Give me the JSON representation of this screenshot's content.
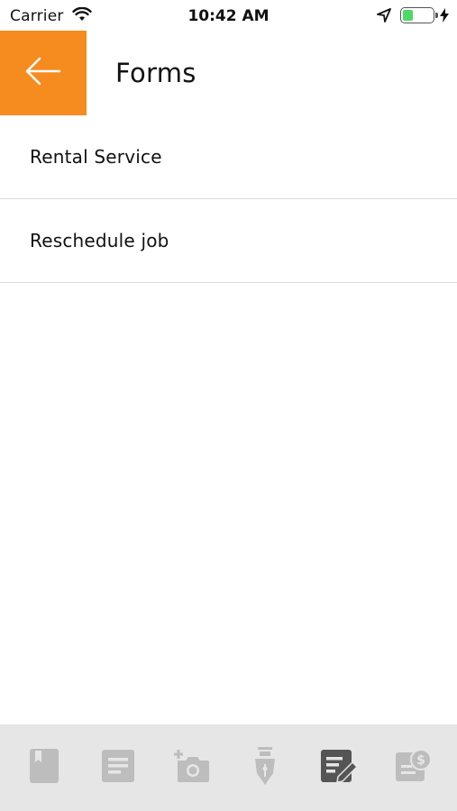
{
  "status_bar": {
    "carrier": "Carrier",
    "time": "10:42 AM",
    "battery_level": 0.3,
    "icons": [
      "wifi-icon",
      "location-arrow-icon",
      "battery-icon",
      "charging-bolt-icon"
    ]
  },
  "header": {
    "back_icon": "arrow-left-icon",
    "title": "Forms",
    "accent_color": "#f68b1f"
  },
  "forms": {
    "items": [
      {
        "label": "Rental Service"
      },
      {
        "label": "Reschedule job"
      }
    ]
  },
  "tab_bar": {
    "items": [
      {
        "icon": "book-icon",
        "active": false
      },
      {
        "icon": "document-icon",
        "active": false
      },
      {
        "icon": "add-photo-icon",
        "active": false
      },
      {
        "icon": "pen-nib-icon",
        "active": false
      },
      {
        "icon": "edit-form-icon",
        "active": true
      },
      {
        "icon": "invoice-dollar-icon",
        "active": false
      }
    ],
    "active_color": "#555555",
    "inactive_color": "#bdbdbd"
  }
}
